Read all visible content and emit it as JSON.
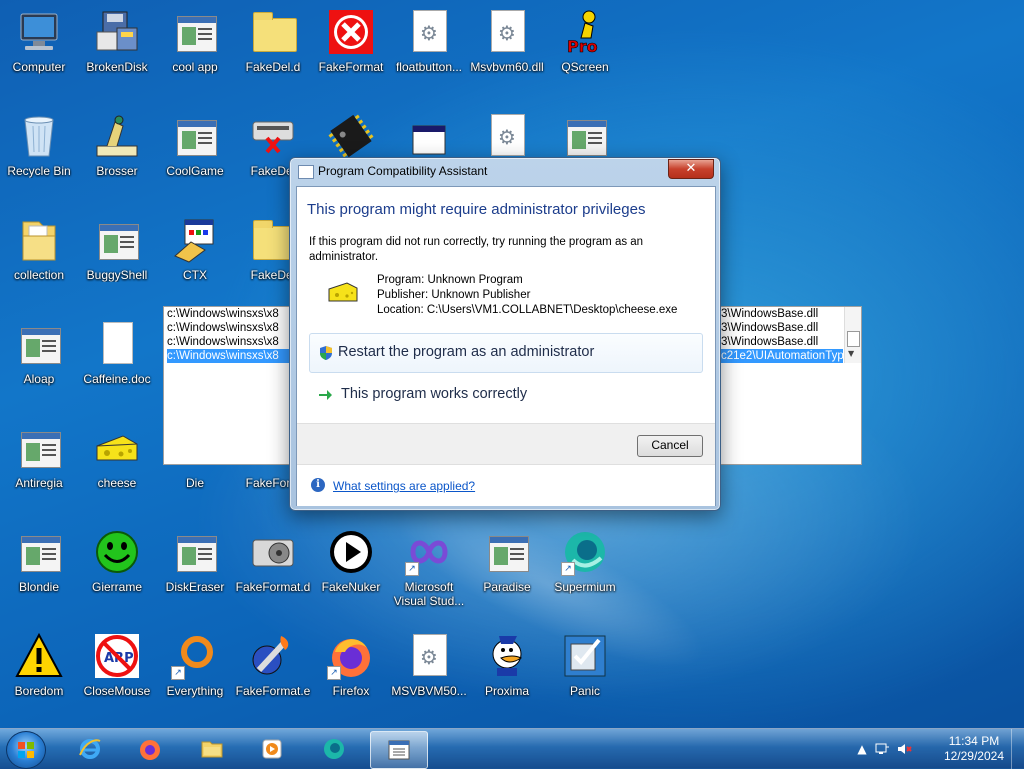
{
  "desktop": {
    "icons": [
      {
        "label": "Computer"
      },
      {
        "label": "BrokenDisk"
      },
      {
        "label": "cool app"
      },
      {
        "label": "FakeDel.d"
      },
      {
        "label": "FakeFormat"
      },
      {
        "label": "floatbutton..."
      },
      {
        "label": "Msvbvm60.dll"
      },
      {
        "label": "QScreen"
      },
      {
        "label": "Recycle Bin"
      },
      {
        "label": "Brosser"
      },
      {
        "label": "CoolGame"
      },
      {
        "label": "FakeDel"
      },
      {
        "label": "collection"
      },
      {
        "label": "BuggyShell"
      },
      {
        "label": "CTX"
      },
      {
        "label": "FakeDel"
      },
      {
        "label": "Aloap"
      },
      {
        "label": "Caffeine.doc"
      },
      {
        "label": "Antiregia"
      },
      {
        "label": "cheese"
      },
      {
        "label": "Die"
      },
      {
        "label": "FakeForm"
      },
      {
        "label": "Blondie"
      },
      {
        "label": "Gierrame"
      },
      {
        "label": "DiskEraser"
      },
      {
        "label": "FakeFormat.d"
      },
      {
        "label": "FakeNuker"
      },
      {
        "label": "Microsoft Visual Stud..."
      },
      {
        "label": "Paradise"
      },
      {
        "label": "Supermium"
      },
      {
        "label": "Boredom"
      },
      {
        "label": "CloseMouse"
      },
      {
        "label": "Everything"
      },
      {
        "label": "FakeFormat.e"
      },
      {
        "label": "Firefox"
      },
      {
        "label": "MSVBVM50..."
      },
      {
        "label": "Proxima"
      },
      {
        "label": "Panic"
      }
    ]
  },
  "listbox": {
    "rows_left": [
      "c:\\Windows\\winsxs\\x8",
      "c:\\Windows\\winsxs\\x8",
      "c:\\Windows\\winsxs\\x8",
      "c:\\Windows\\winsxs\\x8"
    ],
    "rows_right": [
      "3\\WindowsBase.dll",
      "3\\WindowsBase.dll",
      "3\\WindowsBase.dll",
      "c21e2\\UIAutomationTyp"
    ]
  },
  "dialog": {
    "title": "Program Compatibility Assistant",
    "close": "✕",
    "heading": "This program might require administrator privileges",
    "description": "If this program did not run correctly, try running the program as an administrator.",
    "program": "Program: Unknown Program",
    "publisher": "Publisher: Unknown Publisher",
    "location": "Location: C:\\Users\\VM1.COLLABNET\\Desktop\\cheese.exe",
    "option_admin": "Restart the program as an administrator",
    "option_works": "This program works correctly",
    "cancel": "Cancel",
    "help_link": "What settings are applied?"
  },
  "taskbar": {
    "time": "11:34 PM",
    "date": "12/29/2024"
  },
  "colors": {
    "dialog_heading": "#1c3d8c",
    "link": "#0b56c9",
    "selection": "#3399ff"
  }
}
